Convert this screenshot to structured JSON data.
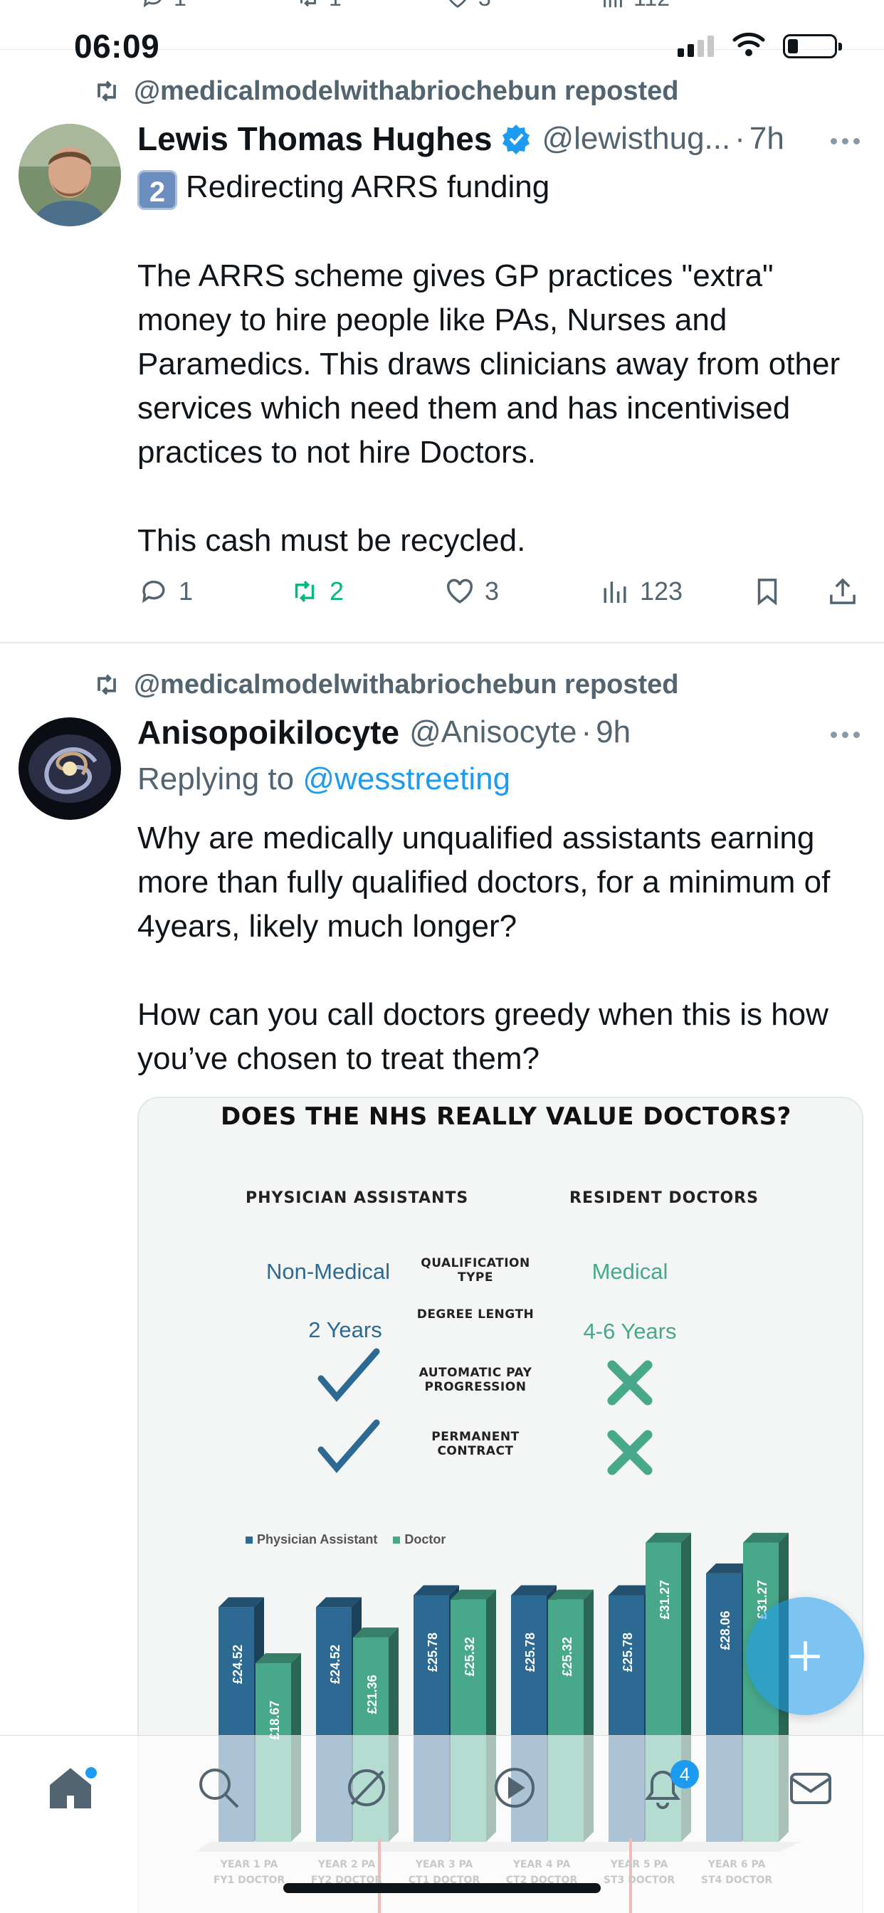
{
  "previous_tweet": {
    "reply_count": "1",
    "repost_count": "1",
    "like_count": "3",
    "view_count": "112"
  },
  "status_bar": {
    "time": "06:09"
  },
  "tweets": [
    {
      "reposted_by": "@medicalmodelwithabriochebun reposted",
      "author_name": "Lewis Thomas Hughes",
      "handle": "@lewisthug...",
      "time": "7h",
      "keycap": "2",
      "text": "Redirecting ARRS funding\n\nThe ARRS scheme gives GP practices \"extra\" money to hire people like PAs, Nurses and Paramedics. This draws clinicians away from other services which need them and has incentivised practices to not hire Doctors.\n\nThis cash must be recycled.",
      "reply_count": "1",
      "repost_count": "2",
      "like_count": "3",
      "view_count": "123"
    },
    {
      "reposted_by": "@medicalmodelwithabriochebun reposted",
      "author_name": "Anisopoikilocyte",
      "handle": "@Anisocyte",
      "time": "9h",
      "replying_to_label": "Replying to",
      "replying_to_handle": "@wesstreeting",
      "text": "Why are medically unqualified assistants earning more than fully qualified doctors, for a minimum of 4years, likely much longer?\n\nHow can you call doctors greedy when this is how you’ve chosen to treat them?"
    }
  ],
  "infographic": {
    "title": "DOES THE NHS REALLY VALUE DOCTORS?",
    "left_heading": "PHYSICIAN ASSISTANTS",
    "right_heading": "RESIDENT DOCTORS",
    "rows": [
      {
        "left": "Non-Medical",
        "label": "QUALIFICATION TYPE",
        "right": "Medical"
      },
      {
        "left": "2 Years",
        "label": "DEGREE LENGTH",
        "right": "4-6 Years"
      },
      {
        "left": "tick",
        "label": "AUTOMATIC PAY PROGRESSION",
        "right": "cross"
      },
      {
        "left": "tick",
        "label": "PERMANENT CONTRACT",
        "right": "cross"
      }
    ]
  },
  "chart_data": {
    "type": "bar",
    "categories": [
      [
        "YEAR 1 PA",
        "FY1 DOCTOR"
      ],
      [
        "YEAR 2 PA",
        "FY2 DOCTOR"
      ],
      [
        "YEAR 3 PA",
        "CT1 DOCTOR"
      ],
      [
        "YEAR 4 PA",
        "CT2 DOCTOR"
      ],
      [
        "YEAR 5 PA",
        "ST3 DOCTOR"
      ],
      [
        "YEAR 6 PA",
        "ST4 DOCTOR"
      ]
    ],
    "series": [
      {
        "name": "Physician Assistant",
        "color": "#2d6a93",
        "values": [
          24.52,
          24.52,
          25.78,
          25.78,
          25.78,
          28.06
        ],
        "labels": [
          "£24.52",
          "£24.52",
          "£25.78",
          "£25.78",
          "£25.78",
          "£28.06"
        ]
      },
      {
        "name": "Doctor",
        "color": "#48a98a",
        "values": [
          18.67,
          21.36,
          25.32,
          25.32,
          31.27,
          31.27
        ],
        "labels": [
          "£18.67",
          "£21.36",
          "£25.32",
          "£25.32",
          "£31.27",
          "£31.27"
        ]
      }
    ],
    "title": "",
    "xlabel": "",
    "ylabel": "",
    "legend": "top-left",
    "grid": false
  },
  "notifications_badge": "4",
  "colors": {
    "accent": "#1d9bf0",
    "repost_green": "#00ba7c",
    "muted": "#536471"
  }
}
